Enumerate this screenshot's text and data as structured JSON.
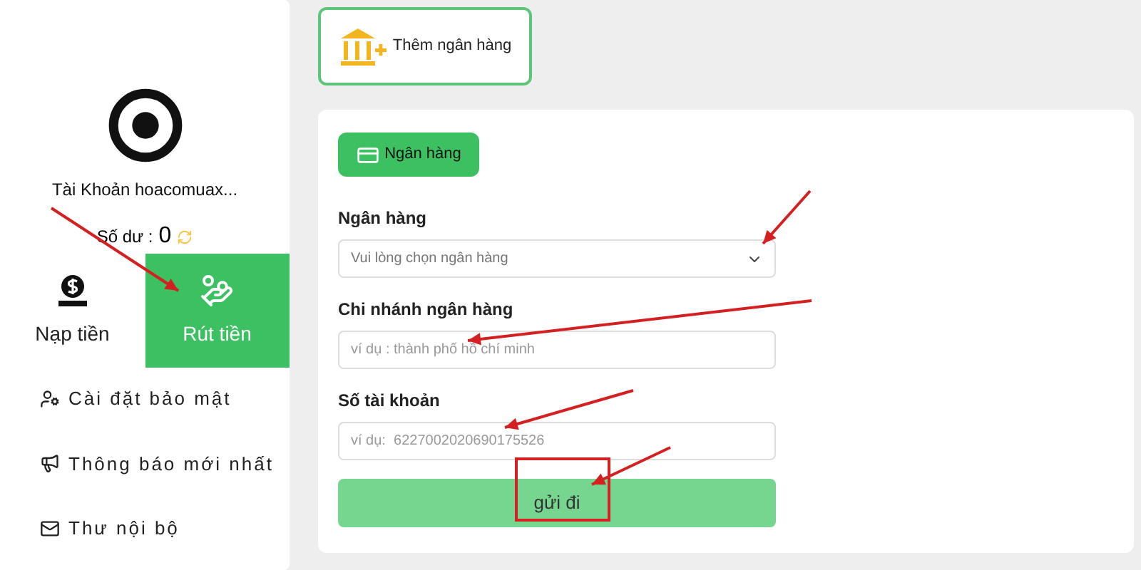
{
  "account": {
    "name": "Tài Khoản hoacomuax...",
    "balance_label": "Số dư :",
    "balance": "0"
  },
  "tabs": [
    {
      "label": "Nạp tiền",
      "kind": "deposit",
      "selected": false
    },
    {
      "label": "Rút tiền",
      "kind": "withdraw",
      "selected": true
    }
  ],
  "menu": [
    {
      "label": "Cài đặt bảo mật",
      "kind": "security"
    },
    {
      "label": "Thông báo mới nhất",
      "kind": "announce"
    },
    {
      "label": "Thư nội bộ",
      "kind": "mail"
    }
  ],
  "add_bank_button": "Thêm ngân hàng",
  "form": {
    "chip": "Ngân hàng",
    "fields": [
      {
        "label": "Ngân hàng",
        "kind": "select",
        "placeholder": "Vui lòng chọn ngân hàng"
      },
      {
        "label": "Chi nhánh ngân hàng",
        "kind": "text",
        "placeholder": "ví dụ : thành phố hồ chí minh"
      },
      {
        "label": "Số tài khoản",
        "kind": "text",
        "placeholder": "ví dụ:  6227002020690175526"
      }
    ],
    "submit": "gửi đi"
  }
}
